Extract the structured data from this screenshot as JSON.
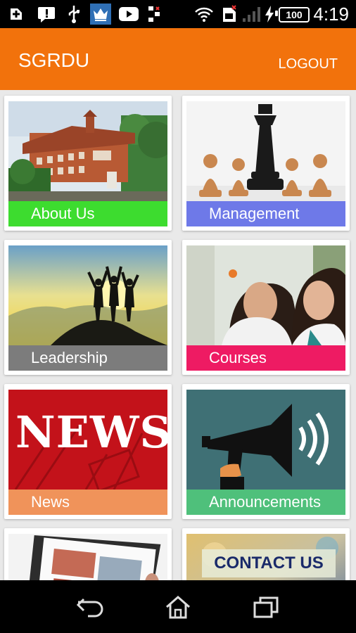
{
  "status_bar": {
    "time": "4:19",
    "battery": "100",
    "icons": [
      "add-icon",
      "message-icon",
      "usb-icon",
      "crown-app-icon",
      "youtube-icon",
      "data-icon",
      "wifi-icon",
      "sim-icon",
      "signal-icon",
      "charging-icon"
    ]
  },
  "app_bar": {
    "title": "SGRDU",
    "logout_label": "LOGOUT",
    "color": "#f2720c"
  },
  "tiles": [
    {
      "label": "About Us",
      "caption_color": "#3ddc2f",
      "image": "university-building-photo"
    },
    {
      "label": "Management",
      "caption_color": "#6e79e8",
      "image": "chess-king-photo"
    },
    {
      "label": "Leadership",
      "caption_color": "#7c7c7c",
      "image": "mountain-silhouettes-photo"
    },
    {
      "label": "Courses",
      "caption_color": "#ee1b63",
      "image": "students-photo"
    },
    {
      "label": "News",
      "caption_color": "#f0935a",
      "image": "news-banner-photo",
      "image_text": "NEWS"
    },
    {
      "label": "Announcements",
      "caption_color": "#4fc07b",
      "image": "megaphone-illustration"
    },
    {
      "label": "",
      "caption_color": "",
      "image": "gallery-photo"
    },
    {
      "label": "",
      "caption_color": "",
      "image": "contact-us-photo",
      "image_text": "CONTACT US"
    }
  ],
  "nav_bar": {
    "icons": [
      "back-icon",
      "home-icon",
      "recent-apps-icon"
    ]
  }
}
